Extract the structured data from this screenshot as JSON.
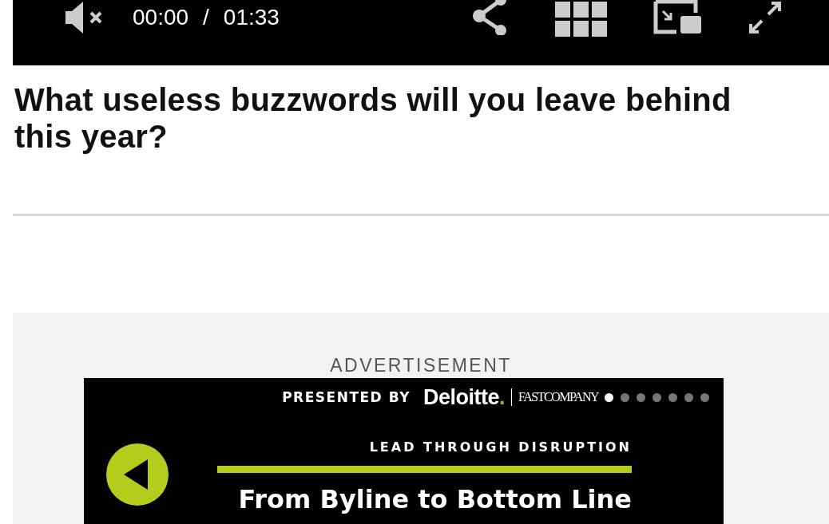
{
  "video_player": {
    "muted": true,
    "current_time": "00:00",
    "separator": "/",
    "duration": "01:33"
  },
  "headline": "What useless buzzwords will you leave behind this year?",
  "advertisement": {
    "label": "ADVERTISEMENT",
    "banner": {
      "presented_by": "PRESENTED BY",
      "sponsor": "Deloitte",
      "sponsor_dot": ".",
      "partner": "FASTCOMPANY",
      "slides": [
        {
          "selected": true
        },
        {
          "selected": false
        },
        {
          "selected": false
        },
        {
          "selected": false
        },
        {
          "selected": false
        },
        {
          "selected": false
        },
        {
          "selected": false
        }
      ],
      "kicker": "LEAD THROUGH DISRUPTION",
      "title": "From Byline to Bottom Line"
    }
  }
}
